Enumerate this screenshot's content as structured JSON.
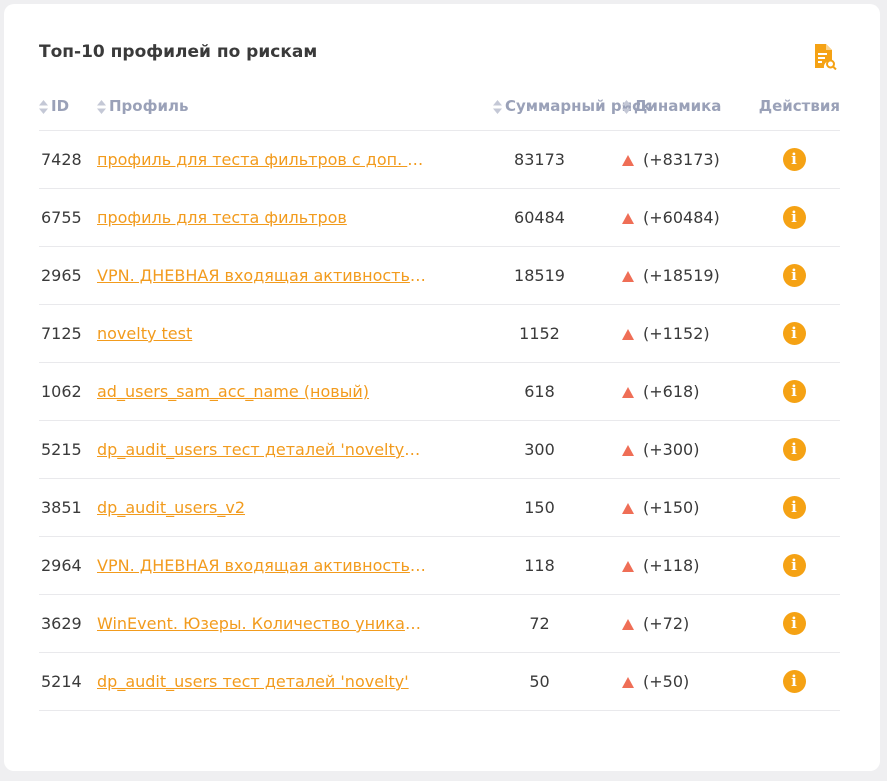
{
  "widget": {
    "title": "Топ-10 профилей по рискам",
    "report_icon": "report-search-icon",
    "accent_color": "#f29b1d"
  },
  "table": {
    "headers": {
      "id": "ID",
      "profile": "Профиль",
      "sum": "Суммарный риск",
      "dyn": "Динамика",
      "act": "Действия"
    },
    "rows": [
      {
        "id": "7428",
        "profile": "профиль для теста фильтров с доп. условием",
        "sum": "83173",
        "dyn": "(+83173)"
      },
      {
        "id": "6755",
        "profile": "профиль для теста фильтров",
        "sum": "60484",
        "dyn": "(+60484)"
      },
      {
        "id": "2965",
        "profile": "VPN. ДНЕВНАЯ входящая активность пользователей",
        "sum": "18519",
        "dyn": "(+18519)"
      },
      {
        "id": "7125",
        "profile": "novelty test",
        "sum": "1152",
        "dyn": "(+1152)"
      },
      {
        "id": "1062",
        "profile": "ad_users_sam_acc_name (новый)",
        "sum": "618",
        "dyn": "(+618)"
      },
      {
        "id": "5215",
        "profile": "dp_audit_users тест деталей 'novelty_rare'",
        "sum": "300",
        "dyn": "(+300)"
      },
      {
        "id": "3851",
        "profile": "dp_audit_users_v2",
        "sum": "150",
        "dyn": "(+150)"
      },
      {
        "id": "2964",
        "profile": "VPN. ДНЕВНАЯ входящая активность пользователей",
        "sum": "118",
        "dyn": "(+118)"
      },
      {
        "id": "3629",
        "profile": "WinEvent. Юзеры. Количество уникальных хостов",
        "sum": "72",
        "dyn": "(+72)"
      },
      {
        "id": "5214",
        "profile": "dp_audit_users тест деталей 'novelty'",
        "sum": "50",
        "dyn": "(+50)"
      }
    ],
    "dyn_icon": "triangle-up-icon",
    "action_icon": "info-icon",
    "up_color": "#ef6e56",
    "info_color": "#f5a214"
  }
}
